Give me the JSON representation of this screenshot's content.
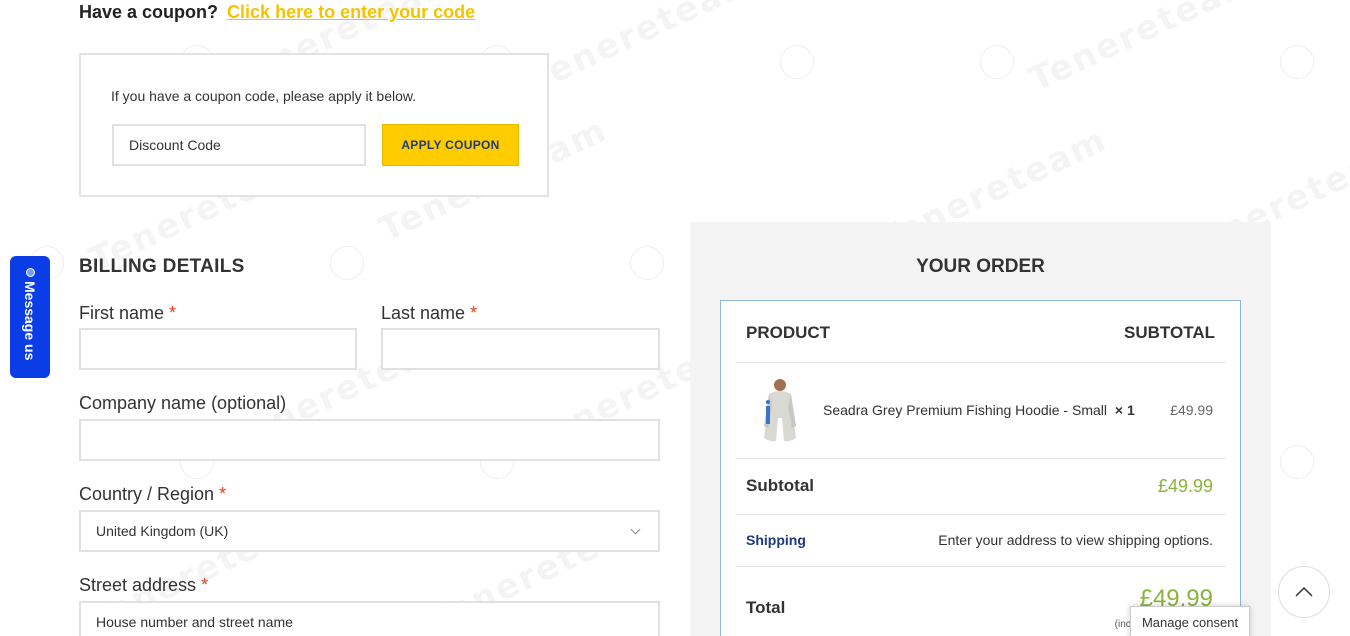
{
  "coupon": {
    "question": "Have a coupon?",
    "link": "Click here to enter your code",
    "description": "If you have a coupon code, please apply it below.",
    "placeholder": "Discount Code",
    "apply_label": "APPLY COUPON"
  },
  "message_tab": {
    "label": "Message us"
  },
  "billing": {
    "title": "BILLING DETAILS",
    "first_name_label": "First name",
    "last_name_label": "Last name",
    "company_label": "Company name (optional)",
    "country_label": "Country / Region",
    "country_value": "United Kingdom (UK)",
    "street_label": "Street address",
    "street_placeholder": "House number and street name",
    "required_mark": "*"
  },
  "order": {
    "title": "YOUR ORDER",
    "product_header": "PRODUCT",
    "subtotal_header": "SUBTOTAL",
    "item": {
      "name": "Seadra Grey Premium Fishing Hoodie - Small",
      "qty": "× 1",
      "price": "£49.99"
    },
    "subtotal_label": "Subtotal",
    "subtotal_value": "£49.99",
    "shipping_label": "Shipping",
    "shipping_text": "Enter your address to view shipping options.",
    "total_label": "Total",
    "total_value": "£49.99",
    "incl_text": "(incl"
  },
  "consent": {
    "label": "Manage consent"
  },
  "watermark": {
    "text": "Tenereteam"
  },
  "colors": {
    "accent": "#ffcc00",
    "price": "#8bb33a",
    "link": "#1e3a78",
    "message_tab": "#0b3de6"
  },
  "icons": {
    "scroll_top": "chevron-up-icon",
    "country_select": "chevron-down-icon"
  }
}
